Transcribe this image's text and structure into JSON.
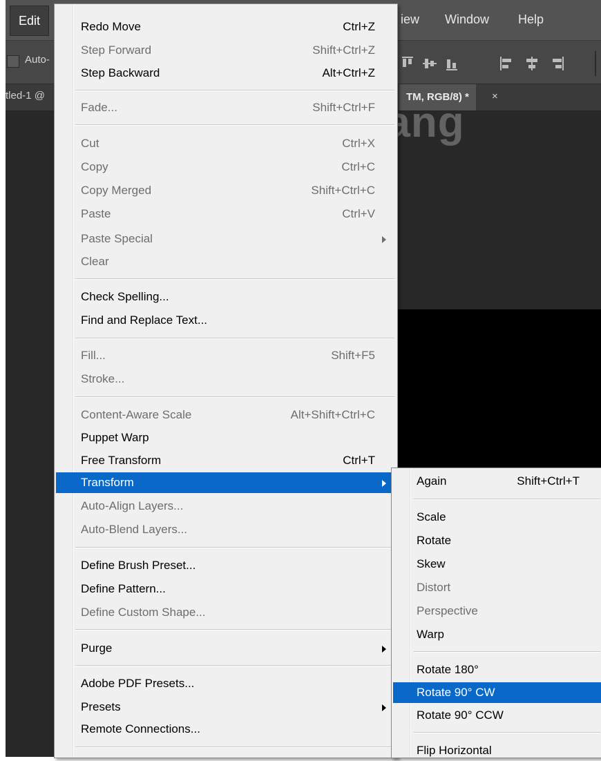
{
  "menubar": {
    "edit": "Edit",
    "view": "iew",
    "window": "Window",
    "help": "Help"
  },
  "options": {
    "auto": "Auto-"
  },
  "tabs": {
    "left": "tled-1 @",
    "right": "TM, RGB/8) *",
    "close": "×"
  },
  "watermark": {
    "text": "uantrimang"
  },
  "edit_menu": {
    "redo_move": {
      "label": "Redo Move",
      "shortcut": "Ctrl+Z"
    },
    "step_forward": {
      "label": "Step Forward",
      "shortcut": "Shift+Ctrl+Z"
    },
    "step_backward": {
      "label": "Step Backward",
      "shortcut": "Alt+Ctrl+Z"
    },
    "fade": {
      "label": "Fade...",
      "shortcut": "Shift+Ctrl+F"
    },
    "cut": {
      "label": "Cut",
      "shortcut": "Ctrl+X"
    },
    "copy": {
      "label": "Copy",
      "shortcut": "Ctrl+C"
    },
    "copy_merged": {
      "label": "Copy Merged",
      "shortcut": "Shift+Ctrl+C"
    },
    "paste": {
      "label": "Paste",
      "shortcut": "Ctrl+V"
    },
    "paste_special": {
      "label": "Paste Special"
    },
    "clear": {
      "label": "Clear"
    },
    "check_spelling": {
      "label": "Check Spelling..."
    },
    "find_replace": {
      "label": "Find and Replace Text..."
    },
    "fill": {
      "label": "Fill...",
      "shortcut": "Shift+F5"
    },
    "stroke": {
      "label": "Stroke..."
    },
    "content_aware_scale": {
      "label": "Content-Aware Scale",
      "shortcut": "Alt+Shift+Ctrl+C"
    },
    "puppet_warp": {
      "label": "Puppet Warp"
    },
    "free_transform": {
      "label": "Free Transform",
      "shortcut": "Ctrl+T"
    },
    "transform": {
      "label": "Transform"
    },
    "auto_align": {
      "label": "Auto-Align Layers..."
    },
    "auto_blend": {
      "label": "Auto-Blend Layers..."
    },
    "define_brush": {
      "label": "Define Brush Preset..."
    },
    "define_pattern": {
      "label": "Define Pattern..."
    },
    "define_shape": {
      "label": "Define Custom Shape..."
    },
    "purge": {
      "label": "Purge"
    },
    "pdf_presets": {
      "label": "Adobe PDF Presets..."
    },
    "presets": {
      "label": "Presets"
    },
    "remote_connections": {
      "label": "Remote Connections..."
    }
  },
  "transform_menu": {
    "again": {
      "label": "Again",
      "shortcut": "Shift+Ctrl+T"
    },
    "scale": {
      "label": "Scale"
    },
    "rotate": {
      "label": "Rotate"
    },
    "skew": {
      "label": "Skew"
    },
    "distort": {
      "label": "Distort"
    },
    "perspective": {
      "label": "Perspective"
    },
    "warp": {
      "label": "Warp"
    },
    "rotate_180": {
      "label": "Rotate 180°"
    },
    "rotate_90_cw": {
      "label": "Rotate 90° CW"
    },
    "rotate_90_ccw": {
      "label": "Rotate 90° CCW"
    },
    "flip_horizontal": {
      "label": "Flip Horizontal"
    }
  },
  "colors": {
    "highlight": "#0a69c8",
    "menu_bg": "#f0f0f0",
    "app_bg": "#282828"
  }
}
